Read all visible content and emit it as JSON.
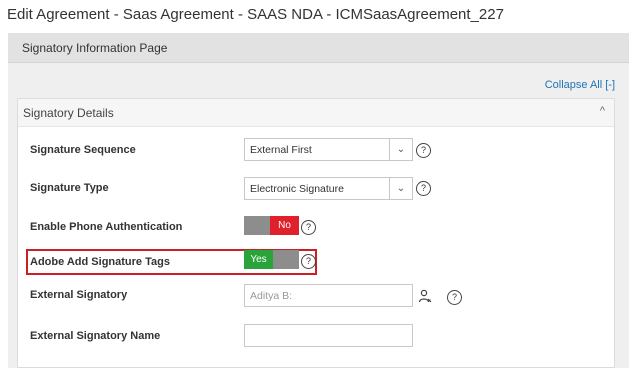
{
  "page": {
    "title": "Edit Agreement - Saas Agreement - SAAS NDA - ICMSaasAgreement_227"
  },
  "panel": {
    "title": "Signatory Information Page",
    "collapse_all": "Collapse All [-]"
  },
  "section": {
    "title": "Signatory Details",
    "chevron": "^"
  },
  "fields": {
    "signature_sequence": {
      "label": "Signature Sequence",
      "value": "External First"
    },
    "signature_type": {
      "label": "Signature Type",
      "value": "Electronic Signature"
    },
    "phone_auth": {
      "label": "Enable Phone Authentication",
      "state": "No"
    },
    "adobe_tags": {
      "label": "Adobe Add Signature Tags",
      "state": "Yes"
    },
    "external_signatory": {
      "label": "External Signatory",
      "placeholder": "Aditya B:"
    },
    "external_signatory_name": {
      "label": "External Signatory Name",
      "value": ""
    }
  },
  "icons": {
    "help": "question-circle-icon",
    "caret": "chevron-down-icon",
    "person": "person-icon"
  },
  "colors": {
    "no": "#e0202a",
    "yes": "#2aa33a",
    "highlight": "#cc1f24",
    "link": "#1f73b7"
  }
}
